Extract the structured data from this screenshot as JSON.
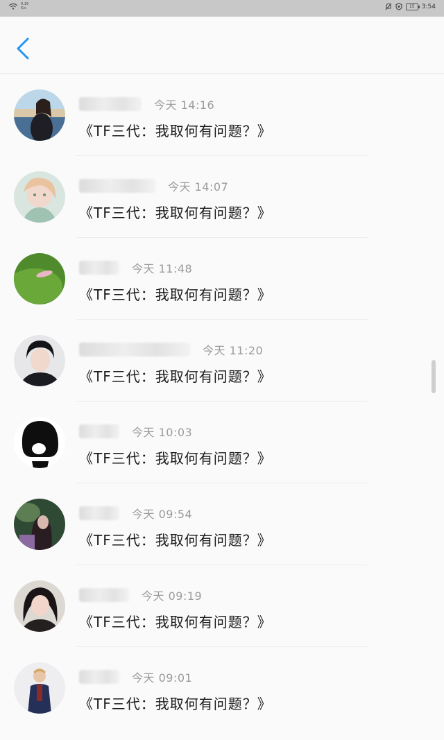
{
  "status_bar": {
    "network_speed": "0.16",
    "network_unit": "K/s",
    "battery": "15",
    "time": "3:54"
  },
  "messages": [
    {
      "time": "今天 14:16",
      "text": "《TF三代：我取何有问题？》"
    },
    {
      "time": "今天 14:07",
      "text": "《TF三代：我取何有问题？》"
    },
    {
      "time": "今天 11:48",
      "text": "《TF三代：我取何有问题？》"
    },
    {
      "time": "今天 11:20",
      "text": "《TF三代：我取何有问题？》"
    },
    {
      "time": "今天 10:03",
      "text": "《TF三代：我取何有问题？》"
    },
    {
      "time": "今天 09:54",
      "text": "《TF三代：我取何有问题？》"
    },
    {
      "time": "今天 09:19",
      "text": "《TF三代：我取何有问题？》"
    },
    {
      "time": "今天 09:01",
      "text": "《TF三代：我取何有问题？》"
    }
  ],
  "colors": {
    "accent": "#2196f3",
    "timestamp": "#9a9a9a",
    "text": "#1a1a1a"
  },
  "icons": {
    "back": "chevron-left-icon",
    "wifi": "wifi-icon",
    "mute": "bell-off-icon",
    "shield": "shield-icon",
    "battery": "battery-icon"
  }
}
